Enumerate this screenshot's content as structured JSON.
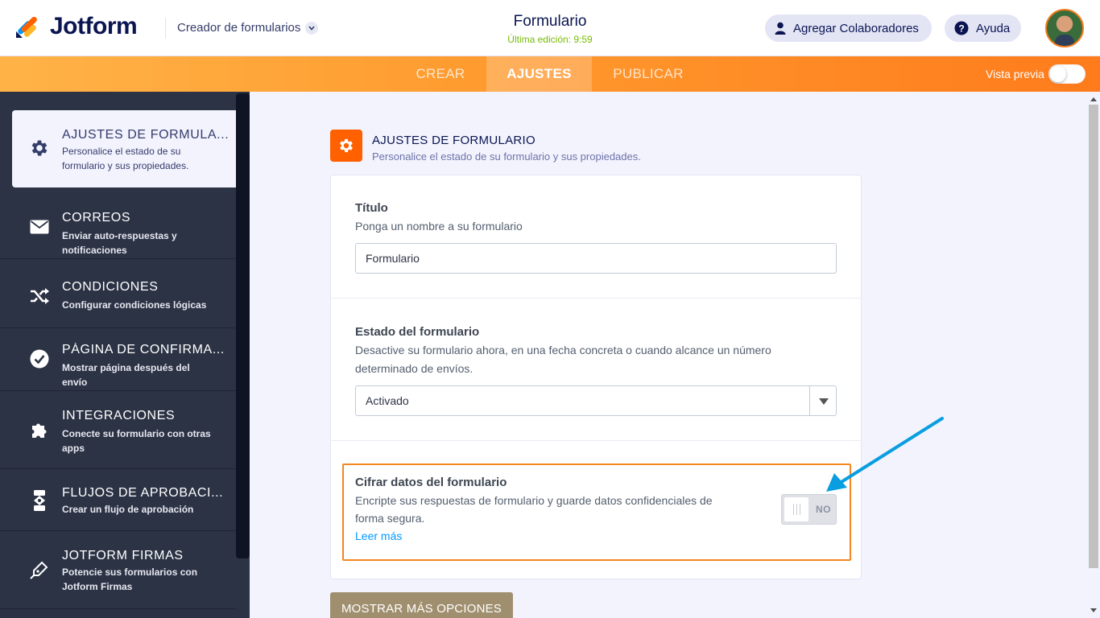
{
  "header": {
    "logo_text": "Jotform",
    "builder_label": "Creador de formularios",
    "form_title": "Formulario",
    "last_edit": "Última edición: 9:59",
    "collaborators_label": "Agregar Colaboradores",
    "help_label": "Ayuda"
  },
  "nav": {
    "tabs": [
      {
        "label": "CREAR"
      },
      {
        "label": "AJUSTES"
      },
      {
        "label": "PUBLICAR"
      }
    ],
    "active_tab": "AJUSTES",
    "preview_label": "Vista previa",
    "preview_enabled": false
  },
  "sidebar": {
    "items": [
      {
        "title": "AJUSTES DE FORMULA...",
        "desc": "Personalice el estado de su formulario y sus propiedades.",
        "icon": "gear-icon",
        "active": true
      },
      {
        "title": "CORREOS",
        "desc": "Enviar auto-respuestas y notificaciones",
        "icon": "envelope-icon"
      },
      {
        "title": "CONDICIONES",
        "desc": "Configurar condiciones lógicas",
        "icon": "shuffle-icon"
      },
      {
        "title": "PÁGINA DE CONFIRMA...",
        "desc": "Mostrar página después del envío",
        "icon": "check-circle-icon"
      },
      {
        "title": "INTEGRACIONES",
        "desc": "Conecte su formulario con otras apps",
        "icon": "puzzle-icon"
      },
      {
        "title": "FLUJOS DE APROBACI...",
        "desc": "Crear un flujo de aprobación",
        "icon": "flow-icon"
      },
      {
        "title": "JOTFORM FIRMAS",
        "desc": "Potencie sus formularios con Jotform Firmas",
        "icon": "pen-icon"
      }
    ]
  },
  "section": {
    "title": "AJUSTES DE FORMULARIO",
    "subtitle": "Personalice el estado de su formulario y sus propiedades."
  },
  "fields": {
    "title": {
      "label": "Título",
      "desc": "Ponga un nombre a su formulario",
      "value": "Formulario"
    },
    "status": {
      "label": "Estado del formulario",
      "desc": "Desactive su formulario ahora, en una fecha concreta o cuando alcance un número determinado de envíos.",
      "value": "Activado"
    },
    "encrypt": {
      "label": "Cifrar datos del formulario",
      "desc": "Encripte sus respuestas de formulario y guarde datos confidenciales de forma segura.",
      "link": "Leer más",
      "toggle_text": "NO",
      "enabled": false
    }
  },
  "more_options_label": "MOSTRAR MÁS OPCIONES",
  "colors": {
    "accent_orange": "#ff6100",
    "sidebar_bg": "#2c3345",
    "highlight_border": "#f4861f",
    "annotation_arrow": "#0a9ee0",
    "link": "#0099ff"
  }
}
